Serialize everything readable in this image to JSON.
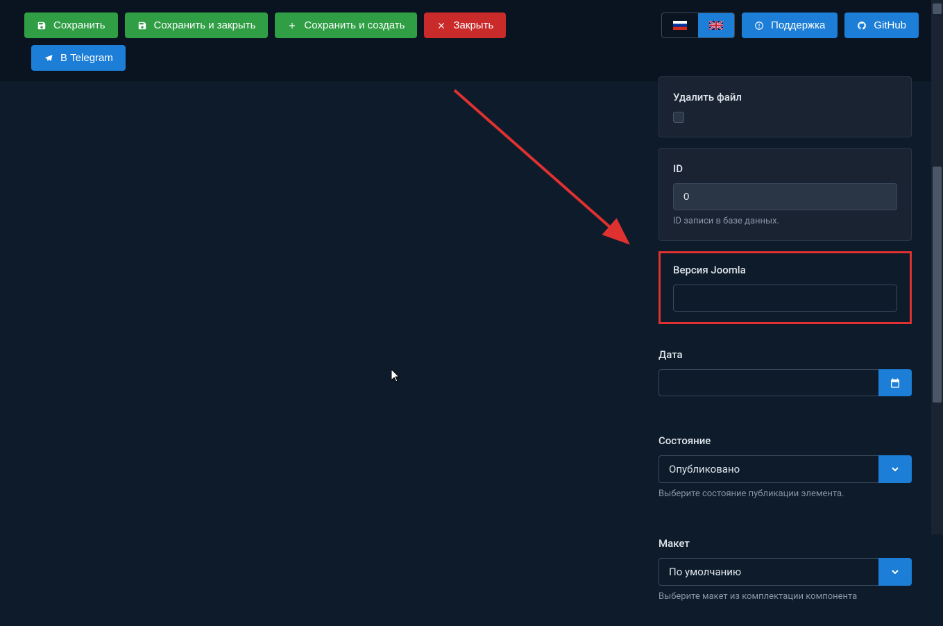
{
  "toolbar": {
    "save": "Сохранить",
    "save_close": "Сохранить и закрыть",
    "save_new": "Сохранить и создать",
    "close": "Закрыть",
    "telegram": "В Telegram",
    "support": "Поддержка",
    "github": "GitHub"
  },
  "fields": {
    "delete_file": {
      "label": "Удалить файл"
    },
    "id": {
      "label": "ID",
      "value": "0",
      "help": "ID записи в базе данных."
    },
    "joomla_version": {
      "label": "Версия Joomla",
      "value": ""
    },
    "date": {
      "label": "Дата",
      "value": ""
    },
    "state": {
      "label": "Состояние",
      "value": "Опубликовано",
      "help": "Выберите состояние публикации элемента."
    },
    "layout": {
      "label": "Макет",
      "value": "По умолчанию",
      "help": "Выберите макет из комплектации компонента"
    }
  }
}
